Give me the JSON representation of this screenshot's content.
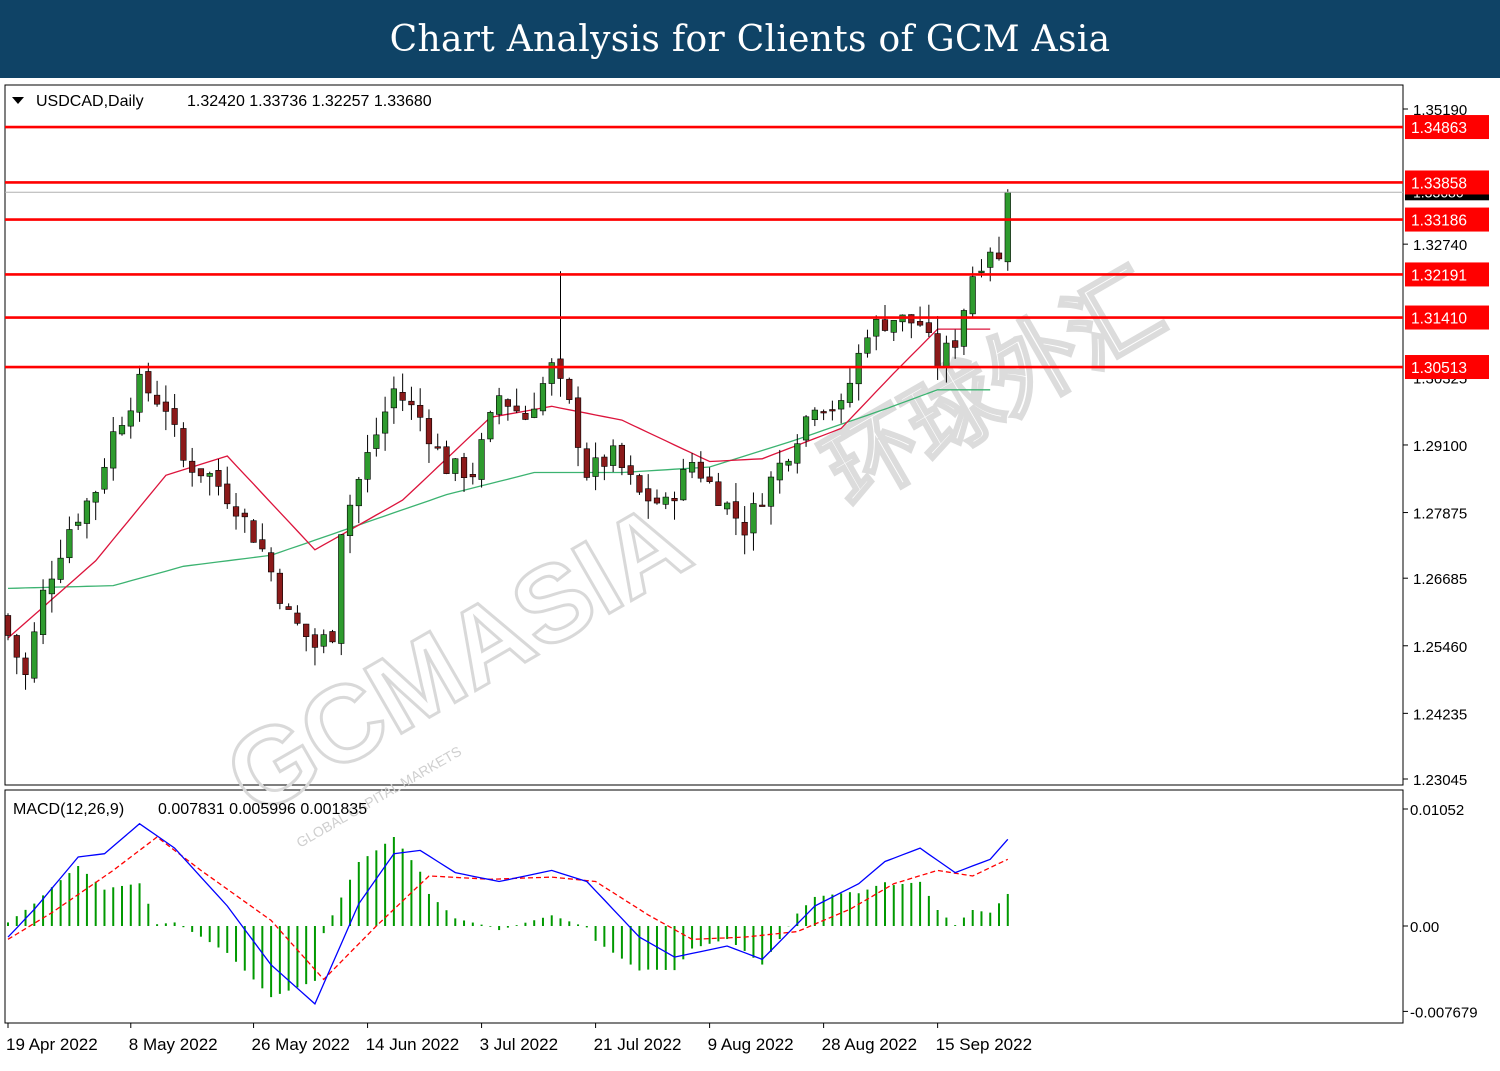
{
  "banner": {
    "title": "Chart Analysis for Clients of GCM Asia"
  },
  "header": {
    "symbol": "USDCAD,Daily",
    "ohlc": "1.32420 1.33736 1.32257 1.33680",
    "macd_label": "MACD(12,26,9)",
    "macd_values": "0.007831 0.005996 0.001835"
  },
  "watermark": {
    "text": "GCMASIA",
    "subtext": "GLOBAL CAPITAL MARKETS",
    "cn": "环球外汇"
  },
  "colors": {
    "banner": "#0f4366",
    "level": "#ff0000",
    "bull": "#2e9b2e",
    "bear": "#8b1a1a",
    "ma_fast": "#dc143c",
    "ma_slow": "#3cb371",
    "macd": "#0000ff",
    "signal": "#ff0000",
    "hist": "#009900"
  },
  "chart_data": {
    "type": "candlestick",
    "price_axis": {
      "ticks": [
        "1.35190",
        "1.32740",
        "1.29100",
        "1.27875",
        "1.26685",
        "1.25460",
        "1.24235",
        "1.23045"
      ],
      "range": [
        1.2302,
        1.3552
      ]
    },
    "current_price": "1.33680",
    "levels": [
      {
        "label": "1.34863",
        "value": 1.34863
      },
      {
        "label": "1.33858",
        "value": 1.33858
      },
      {
        "label": "1.33186",
        "value": 1.33186
      },
      {
        "label": "1.32191",
        "value": 1.32191
      },
      {
        "label": "1.31410",
        "value": 1.3141
      },
      {
        "label": "1.30513",
        "value": 1.30513
      }
    ],
    "hidden_tick": "1.30325",
    "macd_axis": {
      "ticks": [
        "0.01052",
        "0.00",
        "-0.007679"
      ],
      "range": [
        -0.00768,
        0.01052
      ]
    },
    "x_labels": [
      {
        "label": "19 Apr 2022",
        "index": 0
      },
      {
        "label": "8 May 2022",
        "index": 14
      },
      {
        "label": "26 May 2022",
        "index": 28
      },
      {
        "label": "14 Jun 2022",
        "index": 41
      },
      {
        "label": "3 Jul 2022",
        "index": 54
      },
      {
        "label": "21 Jul 2022",
        "index": 67
      },
      {
        "label": "9 Aug 2022",
        "index": 80
      },
      {
        "label": "28 Aug 2022",
        "index": 93
      },
      {
        "label": "15 Sep 2022",
        "index": 106
      }
    ],
    "ma_fast": [
      [
        0,
        1.256
      ],
      [
        10,
        1.27
      ],
      [
        18,
        1.2855
      ],
      [
        25,
        1.289
      ],
      [
        35,
        1.272
      ],
      [
        45,
        1.281
      ],
      [
        55,
        1.296
      ],
      [
        62,
        1.298
      ],
      [
        70,
        1.2955
      ],
      [
        80,
        1.288
      ],
      [
        86,
        1.2885
      ],
      [
        95,
        1.294
      ],
      [
        101,
        1.304
      ],
      [
        106,
        1.312
      ]
    ],
    "ma_slow": [
      [
        0,
        1.265
      ],
      [
        12,
        1.2655
      ],
      [
        20,
        1.269
      ],
      [
        30,
        1.271
      ],
      [
        40,
        1.2765
      ],
      [
        50,
        1.282
      ],
      [
        60,
        1.286
      ],
      [
        70,
        1.286
      ],
      [
        80,
        1.287
      ],
      [
        90,
        1.292
      ],
      [
        100,
        1.2975
      ],
      [
        106,
        1.301
      ]
    ],
    "macd_line": [
      [
        0,
        -0.001
      ],
      [
        3,
        0.0015
      ],
      [
        8,
        0.0062
      ],
      [
        11,
        0.0065
      ],
      [
        15,
        0.0092
      ],
      [
        19,
        0.007
      ],
      [
        25,
        0.0018
      ],
      [
        30,
        -0.0035
      ],
      [
        35,
        -0.007
      ],
      [
        40,
        0.002
      ],
      [
        44,
        0.0065
      ],
      [
        47,
        0.0068
      ],
      [
        51,
        0.0048
      ],
      [
        56,
        0.004
      ],
      [
        62,
        0.005
      ],
      [
        66,
        0.004
      ],
      [
        72,
        -0.001
      ],
      [
        76,
        -0.0028
      ],
      [
        82,
        -0.0018
      ],
      [
        86,
        -0.003
      ],
      [
        92,
        0.0018
      ],
      [
        97,
        0.0038
      ],
      [
        100,
        0.0058
      ],
      [
        104,
        0.007
      ],
      [
        108,
        0.0048
      ],
      [
        112,
        0.006
      ],
      [
        114,
        0.0078
      ]
    ],
    "signal_line": [
      [
        0,
        -0.0012
      ],
      [
        5,
        0.0012
      ],
      [
        12,
        0.005
      ],
      [
        17,
        0.008
      ],
      [
        22,
        0.005
      ],
      [
        30,
        0.0005
      ],
      [
        36,
        -0.0048
      ],
      [
        42,
        0.0
      ],
      [
        48,
        0.0045
      ],
      [
        55,
        0.0042
      ],
      [
        62,
        0.0044
      ],
      [
        67,
        0.004
      ],
      [
        73,
        0.001
      ],
      [
        78,
        -0.0012
      ],
      [
        84,
        -0.001
      ],
      [
        90,
        -0.0005
      ],
      [
        96,
        0.0015
      ],
      [
        101,
        0.0038
      ],
      [
        106,
        0.005
      ],
      [
        110,
        0.0045
      ],
      [
        114,
        0.006
      ]
    ],
    "ylim": [
      1.2302,
      1.3552
    ]
  }
}
